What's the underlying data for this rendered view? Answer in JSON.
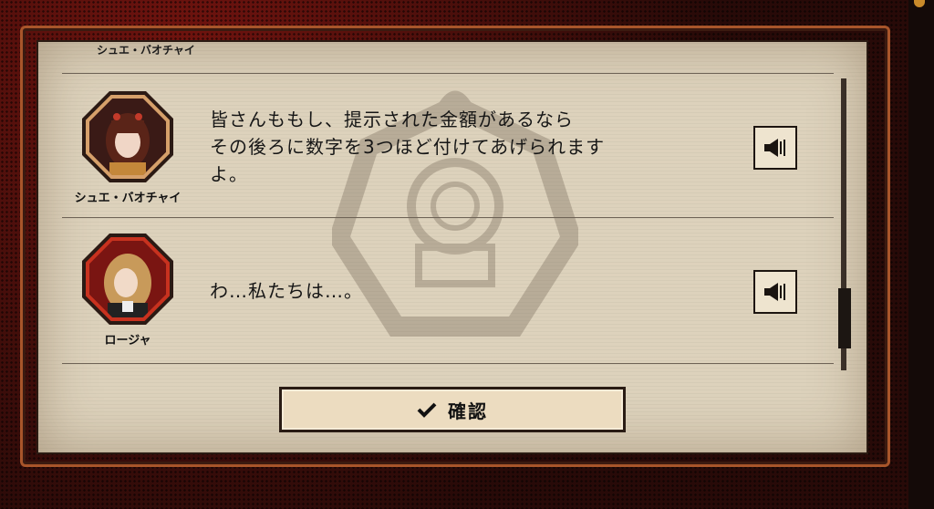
{
  "dialog_log": {
    "entries": [
      {
        "speaker": "シュエ・バオチャイ",
        "text_lines": [
          "皆さんももし、提示された金額があるなら",
          "その後ろに数字を3つほど付けてあげられます",
          "よ。"
        ]
      },
      {
        "speaker": "ロージャ",
        "text_lines": [
          "わ…私たちは…。"
        ]
      }
    ],
    "partial_top_speaker": "シュエ・バオチャイ"
  },
  "confirm_button": {
    "label": "確認"
  },
  "icons": {
    "voice": "speaker-icon",
    "confirm": "checkmark-icon"
  },
  "colors": {
    "frame_red": "#6b1510",
    "frame_orange": "#a8552a",
    "panel_paper": "#ddd2bc",
    "button_bg": "#ecdcc0"
  }
}
